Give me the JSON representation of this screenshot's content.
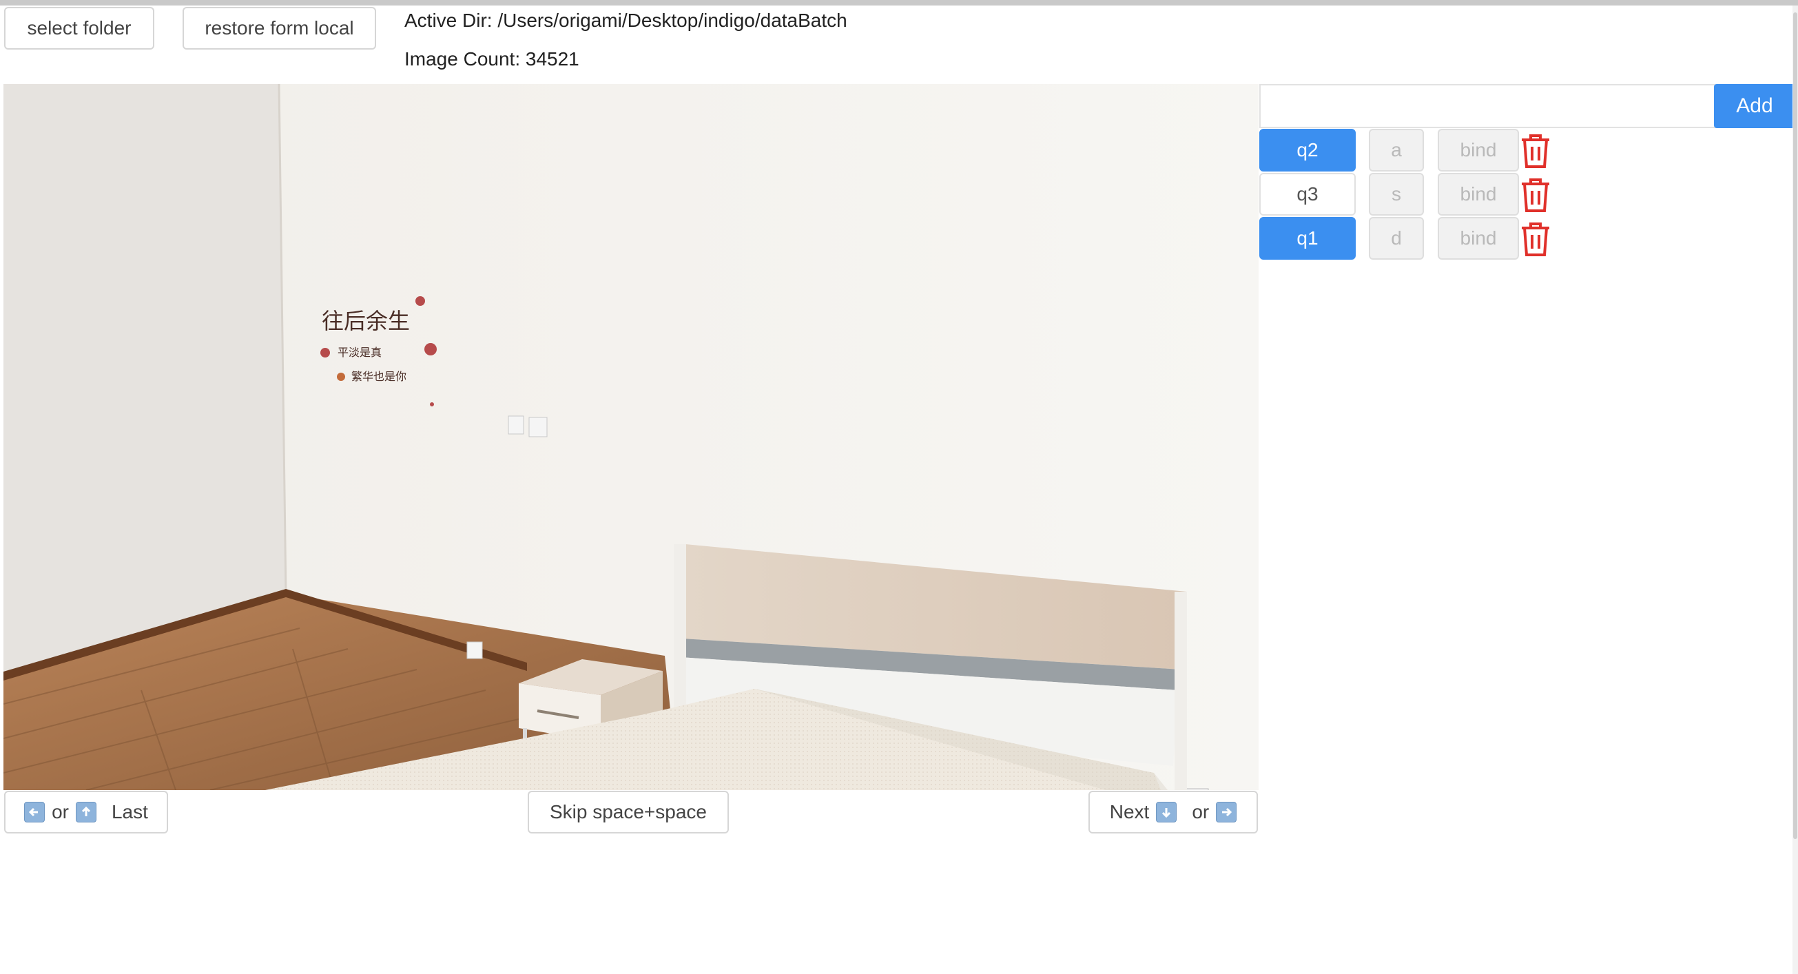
{
  "toolbar": {
    "select_folder": "select folder",
    "restore_form_local": "restore form local",
    "active_dir": "Active Dir: /Users/origami/Desktop/indigo/dataBatch",
    "image_count": "Image Count: 34521"
  },
  "tag_panel": {
    "input_value": "",
    "add_label": "Add",
    "tags": [
      {
        "name": "q2",
        "key": "a",
        "bind_label": "bind",
        "active": true
      },
      {
        "name": "q3",
        "key": "s",
        "bind_label": "bind",
        "active": false
      },
      {
        "name": "q1",
        "key": "d",
        "bind_label": "bind",
        "active": true
      }
    ]
  },
  "poster": {
    "line1": "往后余生",
    "line2": "平淡是真",
    "line3": "繁华也是你"
  },
  "nav": {
    "or_text": "or",
    "last_label": "Last",
    "skip_label": "Skip space+space",
    "next_label": "Next",
    "or_text_2": "or"
  },
  "colors": {
    "accent": "#3b8ff0",
    "trash": "#e0302a"
  },
  "icons": [
    "left-arrow-key-icon",
    "up-arrow-key-icon",
    "down-arrow-key-icon",
    "right-arrow-key-icon",
    "trash-icon"
  ]
}
